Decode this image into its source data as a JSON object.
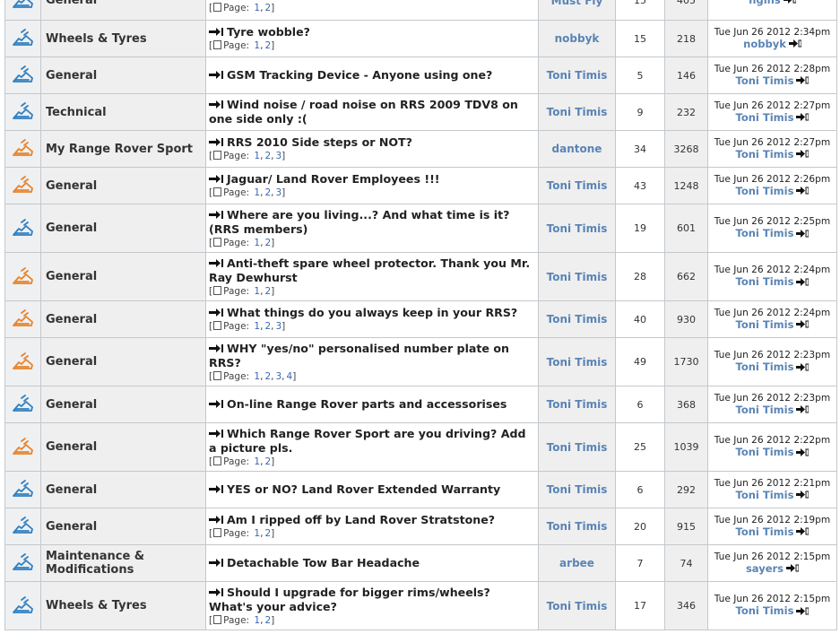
{
  "rows": [
    {
      "forum": "General",
      "title": "",
      "pages": [
        "1",
        "2"
      ],
      "author": "Must Fly",
      "replies": "15",
      "views": "405",
      "last_date": "",
      "last_user": "ngins",
      "hot": false
    },
    {
      "forum": "Wheels & Tyres",
      "title": "Tyre wobble?",
      "pages": [
        "1",
        "2"
      ],
      "author": "nobbyk",
      "replies": "15",
      "views": "218",
      "last_date": "Tue Jun 26 2012 2:34pm",
      "last_user": "nobbyk",
      "hot": false
    },
    {
      "forum": "General",
      "title": "GSM Tracking Device - Anyone using one?",
      "pages": [],
      "author": "Toni Timis",
      "replies": "5",
      "views": "146",
      "last_date": "Tue Jun 26 2012 2:28pm",
      "last_user": "Toni Timis",
      "hot": false
    },
    {
      "forum": "Technical",
      "title": "Wind noise / road noise on RRS 2009 TDV8 on one side only :(",
      "pages": [],
      "author": "Toni Timis",
      "replies": "9",
      "views": "232",
      "last_date": "Tue Jun 26 2012 2:27pm",
      "last_user": "Toni Timis",
      "hot": false
    },
    {
      "forum": "My Range Rover Sport",
      "title": "RRS 2010 Side steps or NOT?",
      "pages": [
        "1",
        "2",
        "3"
      ],
      "author": "dantone",
      "replies": "34",
      "views": "3268",
      "last_date": "Tue Jun 26 2012 2:27pm",
      "last_user": "Toni Timis",
      "hot": true
    },
    {
      "forum": "General",
      "title": "Jaguar/ Land Rover Employees !!!",
      "pages": [
        "1",
        "2",
        "3"
      ],
      "author": "Toni Timis",
      "replies": "43",
      "views": "1248",
      "last_date": "Tue Jun 26 2012 2:26pm",
      "last_user": "Toni Timis",
      "hot": true
    },
    {
      "forum": "General",
      "title": "Where are you living...? And what time is it? (RRS members)",
      "pages": [
        "1",
        "2"
      ],
      "author": "Toni Timis",
      "replies": "19",
      "views": "601",
      "last_date": "Tue Jun 26 2012 2:25pm",
      "last_user": "Toni Timis",
      "hot": false
    },
    {
      "forum": "General",
      "title": "Anti-theft spare wheel protector. Thank you Mr. Ray Dewhurst",
      "pages": [
        "1",
        "2"
      ],
      "author": "Toni Timis",
      "replies": "28",
      "views": "662",
      "last_date": "Tue Jun 26 2012 2:24pm",
      "last_user": "Toni Timis",
      "hot": true
    },
    {
      "forum": "General",
      "title": "What things do you always keep in your RRS?",
      "pages": [
        "1",
        "2",
        "3"
      ],
      "author": "Toni Timis",
      "replies": "40",
      "views": "930",
      "last_date": "Tue Jun 26 2012 2:24pm",
      "last_user": "Toni Timis",
      "hot": true
    },
    {
      "forum": "General",
      "title": "WHY \"yes/no\" personalised number plate on RRS?",
      "pages": [
        "1",
        "2",
        "3",
        "4"
      ],
      "author": "Toni Timis",
      "replies": "49",
      "views": "1730",
      "last_date": "Tue Jun 26 2012 2:23pm",
      "last_user": "Toni Timis",
      "hot": true
    },
    {
      "forum": "General",
      "title": "On-line Range Rover parts and accessorises",
      "pages": [],
      "author": "Toni Timis",
      "replies": "6",
      "views": "368",
      "last_date": "Tue Jun 26 2012 2:23pm",
      "last_user": "Toni Timis",
      "hot": false
    },
    {
      "forum": "General",
      "title": "Which Range Rover Sport are you driving? Add a picture pls.",
      "pages": [
        "1",
        "2"
      ],
      "author": "Toni Timis",
      "replies": "25",
      "views": "1039",
      "last_date": "Tue Jun 26 2012 2:22pm",
      "last_user": "Toni Timis",
      "hot": true
    },
    {
      "forum": "General",
      "title": "YES or NO? Land Rover Extended Warranty",
      "pages": [],
      "author": "Toni Timis",
      "replies": "6",
      "views": "292",
      "last_date": "Tue Jun 26 2012 2:21pm",
      "last_user": "Toni Timis",
      "hot": false
    },
    {
      "forum": "General",
      "title": "Am I ripped off by Land Rover Stratstone?",
      "pages": [
        "1",
        "2"
      ],
      "author": "Toni Timis",
      "replies": "20",
      "views": "915",
      "last_date": "Tue Jun 26 2012 2:19pm",
      "last_user": "Toni Timis",
      "hot": false
    },
    {
      "forum": "Maintenance & Modifications",
      "title": "Detachable Tow Bar Headache",
      "pages": [],
      "author": "arbee",
      "replies": "7",
      "views": "74",
      "last_date": "Tue Jun 26 2012 2:15pm",
      "last_user": "sayers",
      "hot": false
    },
    {
      "forum": "Wheels & Tyres",
      "title": "Should I upgrade for bigger rims/wheels? What's your advice?",
      "pages": [
        "1",
        "2"
      ],
      "author": "Toni Timis",
      "replies": "17",
      "views": "346",
      "last_date": "Tue Jun 26 2012 2:15pm",
      "last_user": "Toni Timis",
      "hot": false
    }
  ],
  "labels": {
    "page_prefix": "Page: "
  },
  "colors": {
    "icon_normal": "#2f7fc0",
    "icon_hot": "#e8832a",
    "link": "#5a84b4"
  },
  "icons": {
    "topic_icon": "shoe-icon",
    "new_post": "arrow-right-icon",
    "page": "page-icon",
    "goto_last": "goto-last-post-icon"
  }
}
